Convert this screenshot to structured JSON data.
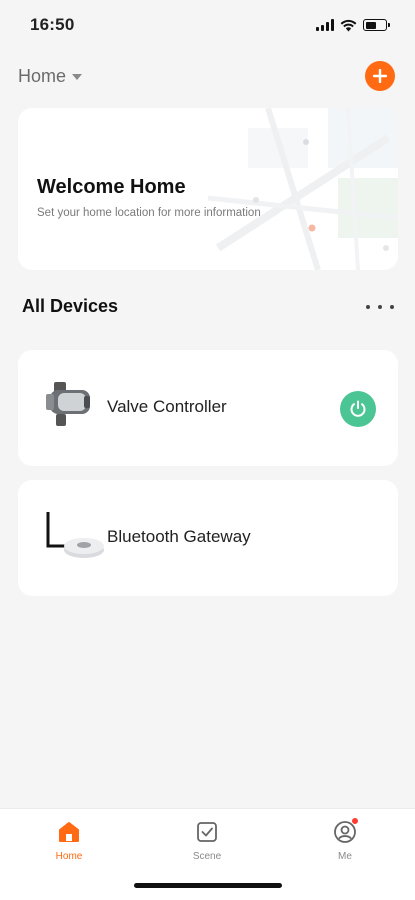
{
  "status_bar": {
    "time": "16:50",
    "icons": [
      "signal-icon",
      "wifi-icon",
      "battery-icon"
    ]
  },
  "header": {
    "home_label": "Home",
    "add_icon": "plus-icon",
    "accent_color": "#ff6a13"
  },
  "welcome_card": {
    "title": "Welcome Home",
    "subtitle": "Set your home location for more information"
  },
  "devices_section": {
    "title": "All Devices",
    "more_icon": "more-horizontal-icon"
  },
  "devices": [
    {
      "name": "Valve Controller",
      "icon": "valve-controller-icon",
      "power_icon": "power-icon",
      "power_color": "#4bc594"
    },
    {
      "name": "Bluetooth Gateway",
      "icon": "bluetooth-gateway-icon"
    }
  ],
  "tab_bar": {
    "tabs": [
      {
        "label": "Home",
        "icon": "home-icon",
        "active": true
      },
      {
        "label": "Scene",
        "icon": "scene-checkbox-icon",
        "active": false
      },
      {
        "label": "Me",
        "icon": "profile-icon",
        "active": false,
        "badge": true
      }
    ]
  }
}
